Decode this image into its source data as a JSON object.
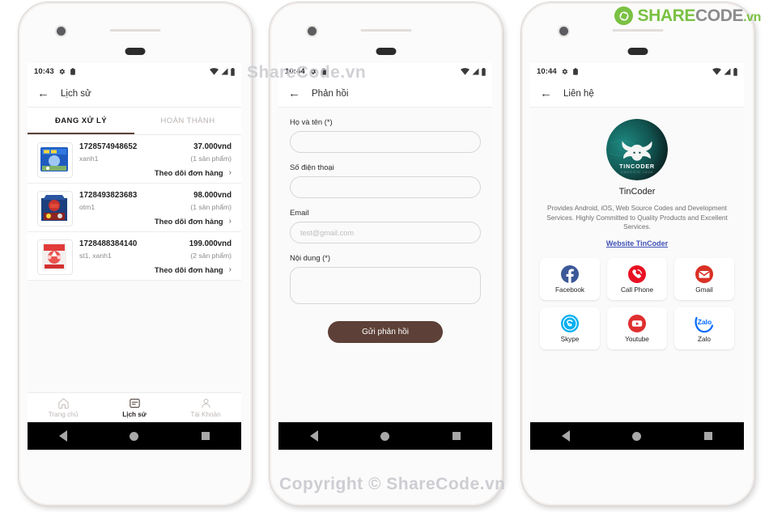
{
  "brand": {
    "share": "SHARE",
    "code": "CODE",
    "vn": ".vn",
    "mark_icon": "sharecode-recycle-icon",
    "green": "#7ac143",
    "gray": "#8c8c8c"
  },
  "watermarks": {
    "top": "ShareCode.vn",
    "bottom": "Copyright © ShareCode.vn"
  },
  "theme": {
    "accent_brown": "#5d4037",
    "screen_bg": "#fafafa",
    "link_blue": "#3f51b5"
  },
  "phone1": {
    "status": {
      "time": "10:43",
      "gear_icon": "gear-icon",
      "clipboard_icon": "clipboard-icon",
      "wifi_icon": "wifi-icon",
      "signal_icon": "signal-icon",
      "battery_icon": "battery-icon"
    },
    "appbar": {
      "back_icon": "back-arrow-icon",
      "title": "Lịch sử"
    },
    "tabs": [
      {
        "label": "ĐANG XỬ LÝ",
        "active": true
      },
      {
        "label": "HOÀN THÀNH",
        "active": false
      }
    ],
    "orders": [
      {
        "id": "1728574948652",
        "price": "37.000vnd",
        "variant": "xanh1",
        "qty": "(1 sản phẩm)",
        "track": "Theo dõi đơn hàng",
        "chevron": "›",
        "thumb_icon": "product-thumb-blue-toy"
      },
      {
        "id": "1728493823683",
        "price": "98.000vnd",
        "variant": "otm1",
        "qty": "(1 sản phẩm)",
        "track": "Theo dõi đơn hàng",
        "chevron": "›",
        "thumb_icon": "product-thumb-optimus-toy"
      },
      {
        "id": "1728488384140",
        "price": "199.000vnd",
        "variant": "st1, xanh1",
        "qty": "(2 sản phẩm)",
        "track": "Theo dõi đơn hàng",
        "chevron": "›",
        "thumb_icon": "product-thumb-red-toy"
      }
    ],
    "bottomnav": [
      {
        "label": "Trang chủ",
        "icon": "home-icon",
        "active": false
      },
      {
        "label": "Lịch sử",
        "icon": "history-icon",
        "active": true
      },
      {
        "label": "Tài Khoản",
        "icon": "account-icon",
        "active": false
      }
    ]
  },
  "phone2": {
    "status": {
      "time": "10:44",
      "gear_icon": "gear-icon",
      "clipboard_icon": "clipboard-icon",
      "wifi_icon": "wifi-icon",
      "signal_icon": "signal-icon",
      "battery_icon": "battery-icon"
    },
    "appbar": {
      "back_icon": "back-arrow-icon",
      "title": "Phản hồi"
    },
    "form": {
      "name_label": "Họ và tên (*)",
      "name_value": "",
      "name_placeholder": "",
      "phone_label": "Số điện thoại",
      "phone_value": "",
      "phone_placeholder": "",
      "email_label": "Email",
      "email_value": "",
      "email_placeholder": "test@gmail.com",
      "content_label": "Nội dung (*)",
      "content_value": "",
      "content_placeholder": "",
      "submit_label": "Gửi phản hồi"
    }
  },
  "phone3": {
    "status": {
      "time": "10:44",
      "gear_icon": "gear-icon",
      "clipboard_icon": "clipboard-icon",
      "wifi_icon": "wifi-icon",
      "signal_icon": "signal-icon",
      "battery_icon": "battery-icon"
    },
    "appbar": {
      "back_icon": "back-arrow-icon",
      "title": "Liên hệ"
    },
    "logo_icon": "tincoder-buffalo-logo",
    "logo_text": "TINCODER",
    "logo_subtext": "ANDROID JAVA",
    "name": "TinCoder",
    "description": "Provides Android, iOS, Web Source Codes and Development Services. Highly Committed to Quality Products and Excellent Services.",
    "website_link": "Website TinCoder",
    "cards": [
      {
        "label": "Facebook",
        "icon": "facebook-icon",
        "color": "#3b5998"
      },
      {
        "label": "Call Phone",
        "icon": "phone-icon",
        "color": "#e81123"
      },
      {
        "label": "Gmail",
        "icon": "gmail-icon",
        "color": "#d93025"
      },
      {
        "label": "Skype",
        "icon": "skype-icon",
        "color": "#00aff0"
      },
      {
        "label": "Youtube",
        "icon": "youtube-icon",
        "color": "#e02f2f"
      },
      {
        "label": "Zalo",
        "icon": "zalo-icon",
        "color": "#0068ff"
      }
    ]
  }
}
